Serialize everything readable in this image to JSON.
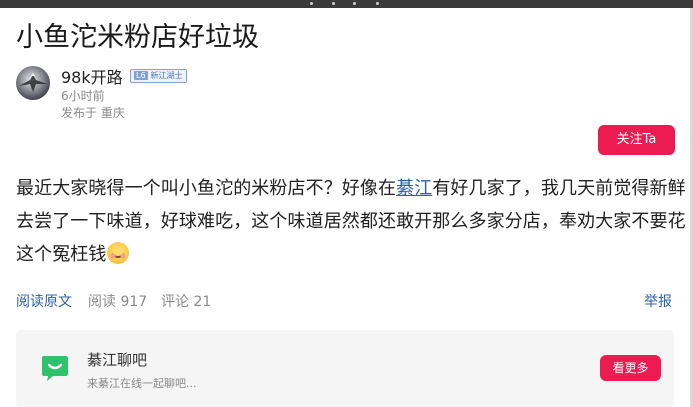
{
  "post": {
    "title": "小鱼沱米粉店好垃圾",
    "author": {
      "name": "98k开路",
      "level": "L6",
      "level_title": "新江湖士",
      "time": "6小时前",
      "location": "发布于 重庆"
    },
    "follow_label": "关注Ta",
    "body_before_link": "最近大家晓得一个叫小鱼沱的米粉店不？好像在",
    "body_link": "綦江",
    "body_after_link": "有好几家了，我几天前觉得新鲜去尝了一下味道，好球难吃，这个味道居然都还敢开那么多家分店，奉劝大家不要花这个冤枉钱",
    "emoji": "grinning-face-emoji"
  },
  "actions": {
    "read_original": "阅读原文",
    "reads": "阅读 917",
    "comments": "评论 21",
    "report": "举报"
  },
  "forum_card": {
    "name": "綦江聊吧",
    "description": "来綦江在线一起聊吧...",
    "more_label": "看更多",
    "icon": "chat-bubble-icon"
  },
  "colors": {
    "accent": "#ec1b52",
    "link": "#2d5fa8",
    "forum_icon": "#2fc26c"
  }
}
